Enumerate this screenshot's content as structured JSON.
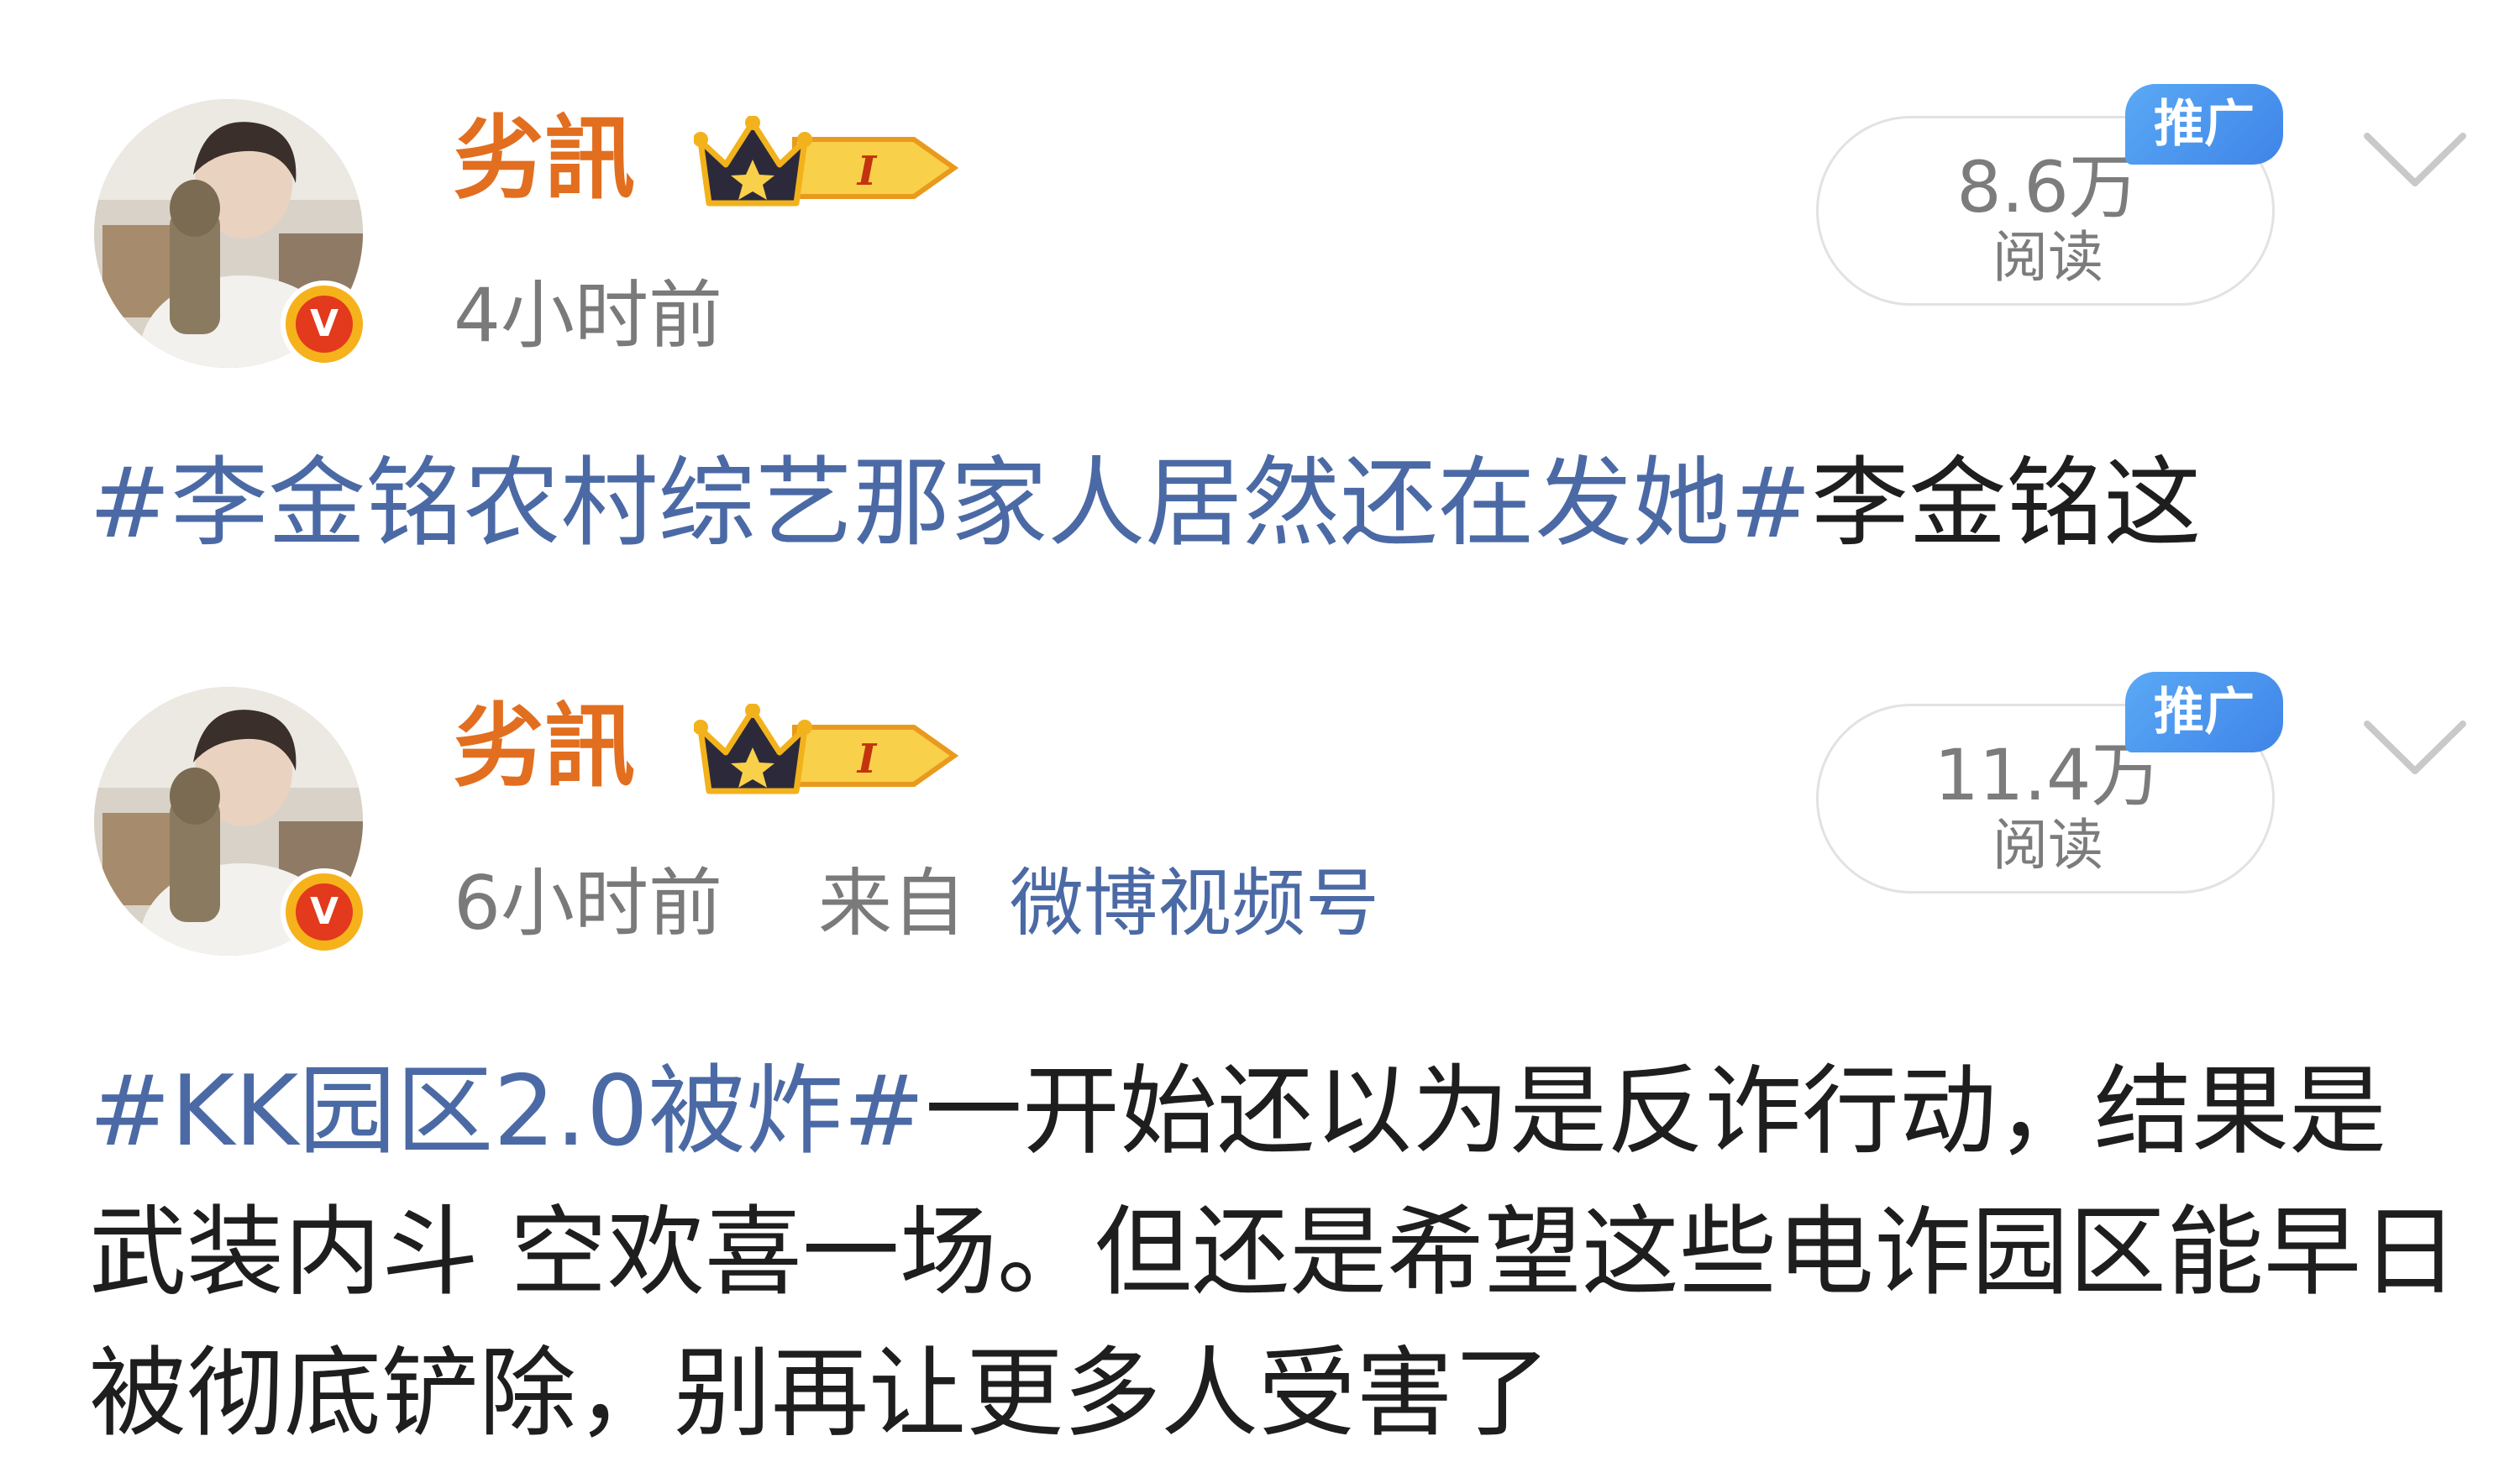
{
  "colors": {
    "username": "#e26e1f",
    "hashtag": "#4b6aa5",
    "meta_gray": "#7a7a7a",
    "promo_blue": "#3f84e8",
    "verified_orange": "#f6b21b",
    "verified_red": "#e3391c"
  },
  "posts": [
    {
      "username": "劣訊",
      "level_badge": {
        "icon": "crown-icon",
        "text": "I"
      },
      "verified_icon": "verified-v-icon",
      "verified_text": "V",
      "timestamp": "4小时前",
      "read_count": "8.6万",
      "read_label": "阅读",
      "promo_tag": "推广",
      "more_icon": "chevron-down-icon",
      "hashtag": "#李金铭农村综艺那家人居然还在发她#",
      "body": "李金铭这"
    },
    {
      "username": "劣訊",
      "level_badge": {
        "icon": "crown-icon",
        "text": "I"
      },
      "verified_icon": "verified-v-icon",
      "verified_text": "V",
      "timestamp": "6小时前",
      "source_prefix": "来自",
      "source": "微博视频号",
      "read_count": "11.4万",
      "read_label": "阅读",
      "promo_tag": "推广",
      "more_icon": "chevron-down-icon",
      "hashtag": "#KK园区2.0被炸#",
      "body": "一开始还以为是反诈行动，结果是武装内斗 空欢喜一场。但还是希望这些电诈园区能早日被彻底铲除，别再让更多人受害了"
    }
  ]
}
